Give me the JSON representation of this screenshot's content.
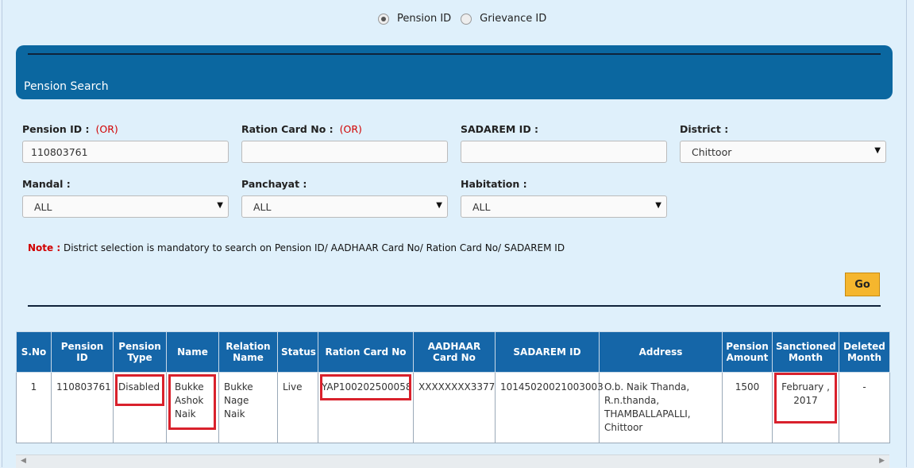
{
  "radio": {
    "options": [
      "Pension ID",
      "Grievance ID"
    ],
    "selected": "Pension ID"
  },
  "panel": {
    "title": "Pension Search"
  },
  "form": {
    "pension_id": {
      "label": "Pension ID :",
      "or": "(OR)",
      "value": "110803761"
    },
    "ration_card": {
      "label": "Ration Card No :",
      "or": "(OR)",
      "value": ""
    },
    "sadarem": {
      "label": "SADAREM ID :",
      "value": ""
    },
    "district": {
      "label": "District :",
      "value": "Chittoor"
    },
    "mandal": {
      "label": "Mandal :",
      "value": "ALL"
    },
    "panchayat": {
      "label": "Panchayat :",
      "value": "ALL"
    },
    "habitation": {
      "label": "Habitation :",
      "value": "ALL"
    }
  },
  "note": {
    "prefix": "Note :",
    "text": "District selection is mandatory to search on Pension ID/ AADHAAR Card No/ Ration Card No/ SADAREM ID"
  },
  "go_label": "Go",
  "table": {
    "headers": [
      "S.No",
      "Pension ID",
      "Pension Type",
      "Name",
      "Relation Name",
      "Status",
      "Ration Card No",
      "AADHAAR Card No",
      "SADAREM ID",
      "Address",
      "Pension Amount",
      "Sanctioned Month",
      "Deleted Month"
    ],
    "rows": [
      [
        "1",
        "110803761",
        "Disabled",
        "Bukke Ashok Naik",
        "Bukke Nage Naik",
        "Live",
        "YAP100202500058",
        "XXXXXXXX3377",
        "10145020021003003",
        "O.b. Naik Thanda, R.n.thanda, THAMBALLAPALLI, Chittoor",
        "1500",
        "February , 2017",
        "-"
      ]
    ]
  },
  "colors": {
    "header_blue": "#0b67a0",
    "highlight": "#d9212c",
    "go": "#f5b62e"
  }
}
